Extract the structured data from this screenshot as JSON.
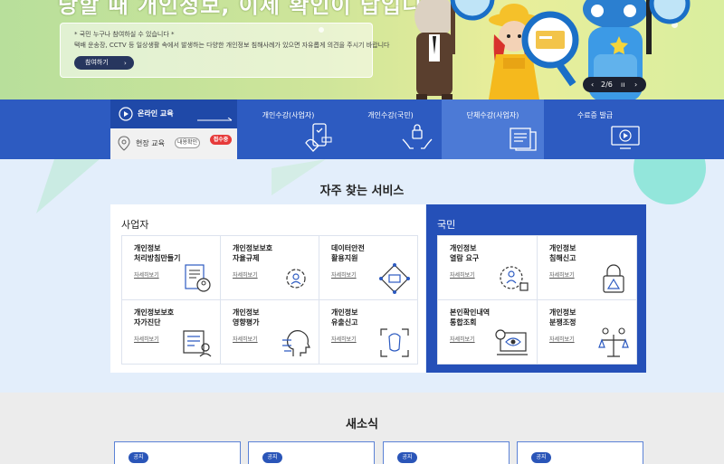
{
  "hero": {
    "title": "당할 때 개인정보, 이제 확인이 답입니다",
    "note": "* 국민 누구나 참여하실 수 있습니다 *",
    "description": "택배 운송장, CCTV 등 일상생활 속에서 발생하는 다양한 개인정보 침해사례가 있으면 자유롭게 의견을 주시기 바랍니다",
    "button": "참여하기",
    "pager": "2/6",
    "prev_icon": "chevron-left-icon",
    "pause_icon": "pause-icon",
    "next_icon": "chevron-right-icon"
  },
  "education": {
    "online_label": "온라인 교육",
    "field_label": "현장 교육",
    "field_chip": "내용확인",
    "field_badge": "접수중",
    "tabs": [
      {
        "label": "개인수강(사업자)",
        "icon": "phone-hand-icon"
      },
      {
        "label": "개인수강(국민)",
        "icon": "hands-lock-icon"
      },
      {
        "label": "단체수강(사업자)",
        "icon": "document-stack-icon"
      },
      {
        "label": "수료증 발급",
        "icon": "monitor-play-icon"
      }
    ]
  },
  "services": {
    "title": "자주 찾는 서비스",
    "business": {
      "title": "사업자",
      "items": [
        {
          "label": "개인정보\n처리방침만들기",
          "more": "자세히보기"
        },
        {
          "label": "개인정보보호\n자율규제",
          "more": "자세히보기"
        },
        {
          "label": "데이터안전\n활용지원",
          "more": "자세히보기"
        },
        {
          "label": "개인정보보호\n자가진단",
          "more": "자세히보기"
        },
        {
          "label": "개인정보\n영향평가",
          "more": "자세히보기"
        },
        {
          "label": "개인정보\n유출신고",
          "more": "자세히보기"
        }
      ]
    },
    "citizen": {
      "title": "국민",
      "items": [
        {
          "label": "개인정보\n열람 요구",
          "more": "자세히보기"
        },
        {
          "label": "개인정보\n침해신고",
          "more": "자세히보기"
        },
        {
          "label": "본인확인내역\n통합조회",
          "more": "자세히보기"
        },
        {
          "label": "개인정보\n분쟁조정",
          "more": "자세히보기"
        }
      ]
    }
  },
  "news": {
    "title": "새소식",
    "cards": [
      {
        "tag": "공지"
      },
      {
        "tag": "공지"
      },
      {
        "tag": "공지"
      },
      {
        "tag": "공지"
      }
    ]
  },
  "colors": {
    "primary": "#2d5bc1",
    "dark_navy": "#27365e",
    "alert": "#e63a3a"
  }
}
